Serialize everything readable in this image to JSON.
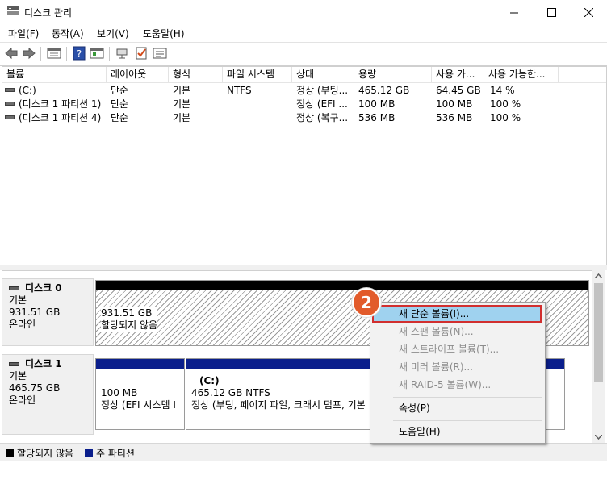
{
  "window": {
    "title": "디스크 관리"
  },
  "menu": [
    "파일(F)",
    "동작(A)",
    "보기(V)",
    "도움말(H)"
  ],
  "toolbar": {
    "icons": [
      "back-icon",
      "forward-icon",
      "volume-list-icon",
      "help-icon",
      "properties-icon",
      "connect-icon",
      "check-icon",
      "settings-list-icon"
    ]
  },
  "table": {
    "columns": [
      "볼륨",
      "레이아웃",
      "형식",
      "파일 시스템",
      "상태",
      "용량",
      "사용 가...",
      "사용 가능한..."
    ],
    "rows": [
      [
        "(C:)",
        "단순",
        "기본",
        "NTFS",
        "정상 (부팅...",
        "465.12 GB",
        "64.45 GB",
        "14 %"
      ],
      [
        "(디스크 1 파티션 1)",
        "단순",
        "기본",
        "",
        "정상 (EFI ...",
        "100 MB",
        "100 MB",
        "100 %"
      ],
      [
        "(디스크 1 파티션 4)",
        "단순",
        "기본",
        "",
        "정상 (복구...",
        "536 MB",
        "536 MB",
        "100 %"
      ]
    ]
  },
  "disks": [
    {
      "name": "디스크 0",
      "type": "기본",
      "size": "931.51 GB",
      "status": "온라인",
      "partitions": [
        {
          "title": "",
          "size": "931.51 GB",
          "status": "할당되지 않음"
        }
      ]
    },
    {
      "name": "디스크 1",
      "type": "기본",
      "size": "465.75 GB",
      "status": "온라인",
      "partitions": [
        {
          "title": "",
          "size": "100 MB",
          "status": "정상 (EFI 시스템 I"
        },
        {
          "title": "(C:)",
          "size": "465.12 GB NTFS",
          "status": "정상 (부팅, 페이지 파일, 크래시 덤프, 기본"
        }
      ]
    }
  ],
  "legend": [
    {
      "label": "할당되지 않음",
      "color": "#000000"
    },
    {
      "label": "주 파티션",
      "color": "#0a1e8c"
    }
  ],
  "context_menu": {
    "items": [
      {
        "label": "새 단순 볼륨(I)...",
        "enabled": true,
        "highlighted": true
      },
      {
        "label": "새 스팬 볼륨(N)...",
        "enabled": false
      },
      {
        "label": "새 스트라이프 볼륨(T)...",
        "enabled": false
      },
      {
        "label": "새 미러 볼륨(R)...",
        "enabled": false
      },
      {
        "label": "새 RAID-5 볼륨(W)...",
        "enabled": false
      },
      {
        "label": "속성(P)",
        "enabled": true
      },
      {
        "label": "도움말(H)",
        "enabled": true
      }
    ]
  },
  "callout": {
    "label": "2"
  },
  "colors": {
    "primary_partition": "#0a1e8c",
    "unallocated": "#000000",
    "highlight": "#9fd2ef",
    "callout": "#e25b2b"
  }
}
